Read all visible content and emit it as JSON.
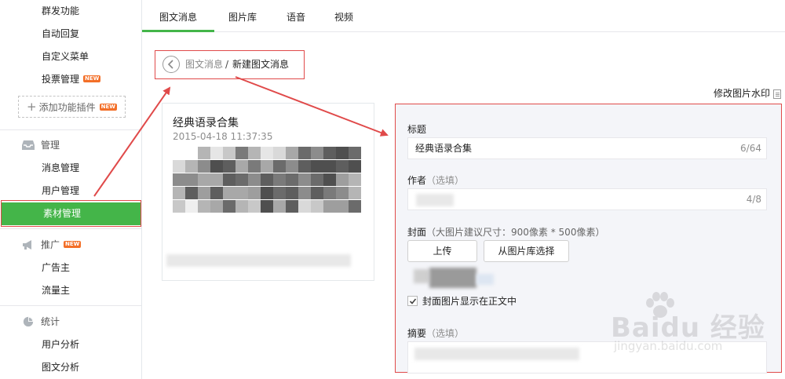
{
  "sidebar": {
    "items": [
      {
        "label": "群发功能"
      },
      {
        "label": "自动回复"
      },
      {
        "label": "自定义菜单"
      },
      {
        "label": "投票管理",
        "badge": "NEW"
      }
    ],
    "add_plugin": {
      "label": "添加功能插件",
      "badge": "NEW"
    },
    "groups": [
      {
        "title": "管理",
        "icon": "inbox-icon",
        "items": [
          "消息管理",
          "用户管理",
          "素材管理"
        ]
      },
      {
        "title": "推广",
        "icon": "megaphone-icon",
        "badge": "NEW",
        "items": [
          "广告主",
          "流量主"
        ]
      },
      {
        "title": "统计",
        "icon": "pie-chart-icon",
        "items": [
          "用户分析",
          "图文分析"
        ]
      }
    ],
    "active_item": "素材管理",
    "accent_color": "#44b549"
  },
  "tabs": [
    {
      "label": "图文消息",
      "active": true
    },
    {
      "label": "图片库"
    },
    {
      "label": "语音"
    },
    {
      "label": "视频"
    }
  ],
  "breadcrumb": {
    "back_icon": "back-circle-icon",
    "parent": "图文消息",
    "separator": "/",
    "current": "新建图文消息"
  },
  "preview": {
    "title": "经典语录合集",
    "date": "2015-04-18 11:37:35"
  },
  "watermark_link": "修改图片水印",
  "editor": {
    "title_label": "标题",
    "title_value": "经典语录合集",
    "title_count": "6/64",
    "author_label": "作者",
    "author_optional": "（选填）",
    "author_count": "4/8",
    "cover_label": "封面",
    "cover_hint": "（大图片建议尺寸：900像素 * 500像素）",
    "upload_button": "上传",
    "library_button": "从图片库选择",
    "show_cover_label": "封面图片显示在正文中",
    "show_cover_checked": true,
    "summary_label": "摘要",
    "summary_optional": "（选填）"
  },
  "site_watermark": {
    "text": "Baidu 经验",
    "url": "jingyan.baidu.com"
  },
  "colors": {
    "annotation_red": "#e04a4a",
    "new_badge": "#f36f28"
  }
}
